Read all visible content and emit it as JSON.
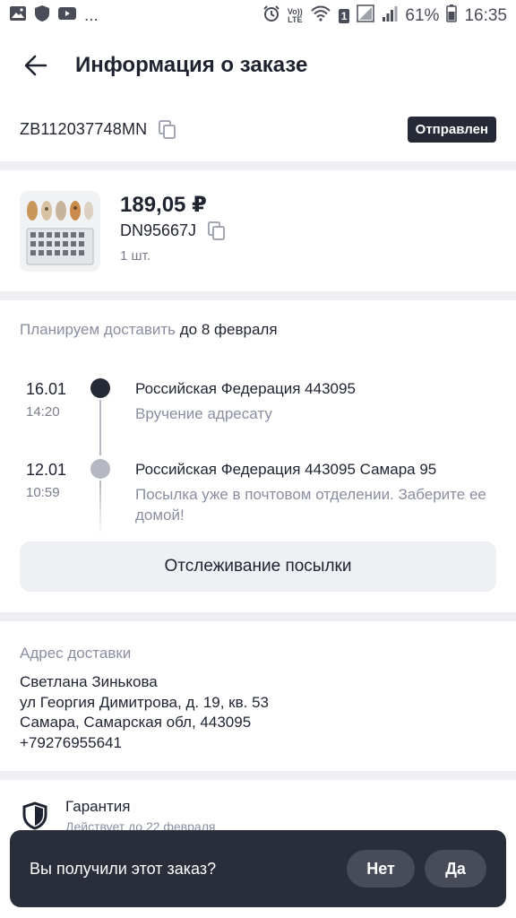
{
  "status_bar": {
    "battery_percent": "61%",
    "time": "16:35",
    "more": "...",
    "volte_label_top": "Vo))",
    "volte_label_bottom": "LTE",
    "sim_badge": "1"
  },
  "header": {
    "title": "Информация о заказе"
  },
  "order": {
    "id": "ZB112037748MN",
    "status": "Отправлен"
  },
  "product": {
    "price": "189,05 ₽",
    "sku": "DN95667J",
    "quantity": "1 шт."
  },
  "delivery": {
    "plan_prefix": "Планируем доставить",
    "plan_date": "до 8 февраля",
    "events": [
      {
        "date": "16.01",
        "time": "14:20",
        "location": "Российская Федерация 443095",
        "description": "Вручение адресату",
        "dot_color": "#262a37"
      },
      {
        "date": "12.01",
        "time": "10:59",
        "location": "Российская Федерация 443095 Самара 95",
        "description": "Посылка уже в почтовом отделении. Заберите ее домой!",
        "dot_color": "#b5b7c2"
      }
    ],
    "track_button": "Отслеживание посылки"
  },
  "address": {
    "label": "Адрес доставки",
    "name": "Светлана Зинькова",
    "street": "ул Георгия Димитрова, д. 19, кв. 53",
    "city": "Самара, Самарская обл, 443095",
    "phone": "+79276955641"
  },
  "guarantee": {
    "title": "Гарантия",
    "subtitle": "Действует до 22 февраля"
  },
  "snackbar": {
    "question": "Вы получили этот заказ?",
    "no_label": "Нет",
    "yes_label": "Да"
  },
  "icons": {
    "back": "arrow-left-icon",
    "copy": "copy-icon",
    "shield": "shield-icon"
  },
  "colors": {
    "accent_dark": "#262a37",
    "muted_text": "#8a8ea0",
    "separator": "#eff0f3"
  }
}
